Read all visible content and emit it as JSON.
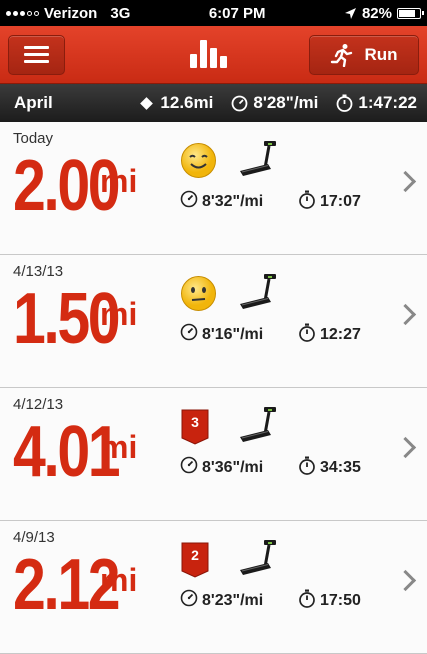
{
  "status_bar": {
    "carrier": "Verizon",
    "network": "3G",
    "time": "6:07 PM",
    "battery_percent": "82%",
    "battery_level": 0.82,
    "signal_bars_filled": 3,
    "signal_bars_total": 5
  },
  "nav": {
    "run_label": "Run",
    "accent_color": "#d42b12"
  },
  "summary": {
    "month": "April",
    "distance": "12.6mi",
    "pace": "8'28\"/mi",
    "duration": "1:47:22"
  },
  "runs": [
    {
      "date": "Today",
      "distance": "2.00",
      "unit": "mi",
      "badge": "smiley-icon",
      "badge_text": "",
      "equipment": "treadmill-icon",
      "pace": "8'32\"/mi",
      "duration": "17:07"
    },
    {
      "date": "4/13/13",
      "distance": "1.50",
      "unit": "mi",
      "badge": "neutral-face-icon",
      "badge_text": "",
      "equipment": "treadmill-icon",
      "pace": "8'16\"/mi",
      "duration": "12:27"
    },
    {
      "date": "4/12/13",
      "distance": "4.01",
      "unit": "mi",
      "badge": "ribbon-badge-icon",
      "badge_text": "3",
      "equipment": "treadmill-icon",
      "pace": "8'36\"/mi",
      "duration": "34:35"
    },
    {
      "date": "4/9/13",
      "distance": "2.12",
      "unit": "mi",
      "badge": "ribbon-badge-icon",
      "badge_text": "2",
      "equipment": "treadmill-icon",
      "pace": "8'23\"/mi",
      "duration": "17:50"
    }
  ]
}
